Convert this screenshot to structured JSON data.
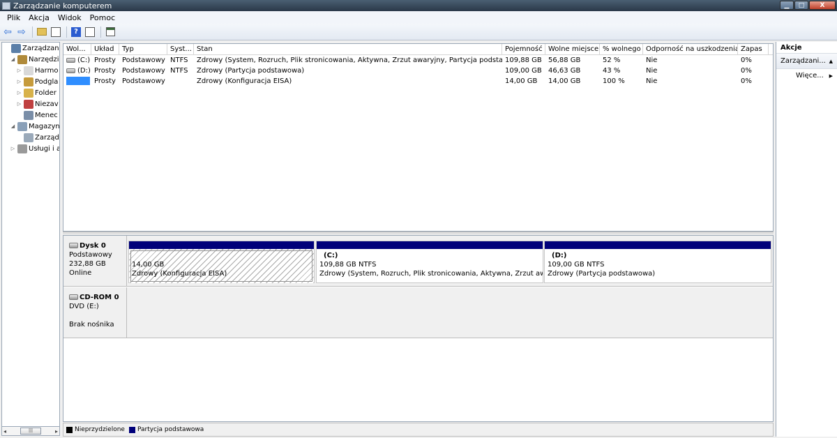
{
  "window": {
    "title": "Zarządzanie komputerem",
    "buttons": {
      "minimize": "▁",
      "maximize": "□",
      "close": "X"
    }
  },
  "menu": [
    "Plik",
    "Akcja",
    "Widok",
    "Pomoc"
  ],
  "toolbar": {
    "back": "⇦",
    "forward": "⇨",
    "help": "?"
  },
  "nav": [
    {
      "label": "Zarządzanie k",
      "indent": 0,
      "expander": "",
      "icon": "computer-icon",
      "color": "#5b7fa8"
    },
    {
      "label": "Narzędzia",
      "indent": 1,
      "expander": "◢",
      "icon": "tools-icon",
      "color": "#b08a3a"
    },
    {
      "label": "Harmo",
      "indent": 2,
      "expander": "▷",
      "icon": "clock-icon",
      "color": "#d9d9d9"
    },
    {
      "label": "Podgla",
      "indent": 2,
      "expander": "▷",
      "icon": "event-viewer-icon",
      "color": "#c69b3c"
    },
    {
      "label": "Folder",
      "indent": 2,
      "expander": "▷",
      "icon": "shared-folder-icon",
      "color": "#d8b24a"
    },
    {
      "label": "Niezav",
      "indent": 2,
      "expander": "▷",
      "icon": "users-icon",
      "color": "#c04040"
    },
    {
      "label": "Menec",
      "indent": 2,
      "expander": "",
      "icon": "device-manager-icon",
      "color": "#7a8ea8"
    },
    {
      "label": "Magazyn",
      "indent": 1,
      "expander": "◢",
      "icon": "storage-icon",
      "color": "#8aa0b8"
    },
    {
      "label": "Zarząd",
      "indent": 2,
      "expander": "",
      "icon": "disk-management-icon",
      "color": "#9aa9b9"
    },
    {
      "label": "Usługi i ap",
      "indent": 1,
      "expander": "▷",
      "icon": "services-icon",
      "color": "#9a9a9a"
    }
  ],
  "navScroll": {
    "left": "◂",
    "thumb": "|||",
    "right": "▸"
  },
  "volumes": {
    "columns": [
      "Wol...",
      "Układ",
      "Typ",
      "Syst...",
      "Stan",
      "Pojemność",
      "Wolne miejsce",
      "% wolnego",
      "Odporność na uszkodzenia",
      "Zapas"
    ],
    "rows": [
      [
        "(C:)",
        "Prosty",
        "Podstawowy",
        "NTFS",
        "Zdrowy (System, Rozruch, Plik stronicowania, Aktywna, Zrzut awaryjny, Partycja podstawowa)",
        "109,88 GB",
        "56,88 GB",
        "52 %",
        "Nie",
        "0%"
      ],
      [
        "(D:)",
        "Prosty",
        "Podstawowy",
        "NTFS",
        "Zdrowy (Partycja podstawowa)",
        "109,00 GB",
        "46,63 GB",
        "43 %",
        "Nie",
        "0%"
      ],
      [
        "",
        "Prosty",
        "Podstawowy",
        "",
        "Zdrowy (Konfiguracja EISA)",
        "14,00 GB",
        "14,00 GB",
        "100 %",
        "Nie",
        "0%"
      ]
    ]
  },
  "disks": [
    {
      "name": "Dysk 0",
      "type": "Podstawowy",
      "size": "232,88 GB",
      "status": "Online",
      "partitions": [
        {
          "label": "",
          "size": "14,00 GB",
          "status": "Zdrowy (Konfiguracja EISA)"
        },
        {
          "label": "(C:)",
          "size": "109,88 GB NTFS",
          "status": "Zdrowy (System, Rozruch, Plik stronicowania, Aktywna, Zrzut awaryjny"
        },
        {
          "label": "(D:)",
          "size": "109,00 GB NTFS",
          "status": "Zdrowy (Partycja podstawowa)"
        }
      ]
    },
    {
      "name": "CD-ROM 0",
      "type": "DVD (E:)",
      "size": "",
      "status": "Brak nośnika",
      "partitions": []
    }
  ],
  "legend": [
    {
      "label": "Nieprzydzielone",
      "color": "#000000"
    },
    {
      "label": "Partycja podstawowa",
      "color": "#00007a"
    }
  ],
  "actions": {
    "header": "Akcje",
    "section": "Zarządzani...",
    "more": "Więce..."
  },
  "colors": {
    "primaryPartition": "#00007a",
    "selectedVolume": "#2f8eff"
  }
}
